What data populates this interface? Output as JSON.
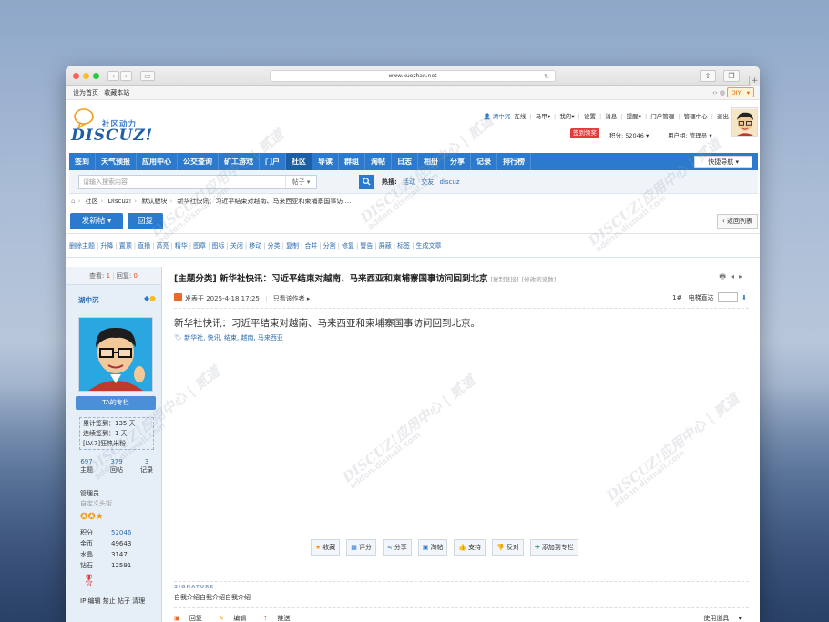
{
  "browser": {
    "url": "www.kuozhan.net",
    "traffic_colors": [
      "#fe5f57",
      "#febc2e",
      "#28c840"
    ]
  },
  "topbar": {
    "set_home": "设为首页",
    "bookmark": "收藏本站",
    "diy": "DIY"
  },
  "logo": {
    "subtitle": "社区动力",
    "brand": "DISCUZ!"
  },
  "user_menu": {
    "username": "湖中沉",
    "status": "在线",
    "horse": "马甲",
    "mine": "我的",
    "settings": "设置",
    "messages": "消息",
    "reminders": "提醒",
    "portal_admin": "门户管理",
    "admin_center": "管理中心",
    "logout": "退出",
    "sign_in_label": "签到领奖",
    "credits_label": "积分: 52046",
    "user_group_label": "用户组: 管理员"
  },
  "nav": {
    "items": [
      "签到",
      "天气预报",
      "应用中心",
      "公交查询",
      "矿工游戏",
      "门户",
      "社区",
      "导读",
      "群组",
      "淘帖",
      "日志",
      "相册",
      "分享",
      "记录",
      "排行榜"
    ],
    "active_index": 6,
    "quick_nav": "快捷导航"
  },
  "search": {
    "placeholder": "请输入搜索内容",
    "type": "帖子",
    "hot_label": "热搜:",
    "hot_items": [
      "活动",
      "交友",
      "discuz"
    ]
  },
  "breadcrumb": [
    "社区",
    "Discuz!",
    "默认版块",
    "新华社快讯：习近平结束对越南、马来西亚和柬埔寨国事访 ..."
  ],
  "actions": {
    "new_post": "发新帖",
    "reply": "回复",
    "back_list": "返回列表"
  },
  "moderation": [
    "删除主题",
    "升降",
    "置顶",
    "直播",
    "高亮",
    "精华",
    "图章",
    "图标",
    "关闭",
    "移动",
    "分类",
    "复制",
    "合并",
    "分割",
    "修复",
    "警告",
    "屏蔽",
    "标签",
    "生成文章"
  ],
  "thread": {
    "views_label": "查看:",
    "views": "1",
    "replies_label": "回复:",
    "replies": "0",
    "title": "[主题分类] 新华社快讯：习近平结束对越南、马来西亚和柬埔寨国事访问回到北京",
    "copy_link": "[复制链接]",
    "edit_views": "[修改浏览数]"
  },
  "author": {
    "name": "湖中沉",
    "column_button": "TA的专栏",
    "sign_total": "累计签到：135 天",
    "sign_streak": "连续签到：1 天",
    "sign_level": "[LV.7]狂热米粉",
    "stats": [
      {
        "value": "697",
        "label": "主题"
      },
      {
        "value": "379",
        "label": "回帖"
      },
      {
        "value": "3",
        "label": "记录"
      }
    ],
    "group": "管理员",
    "custom_title": "自定义头衔",
    "credits": [
      {
        "key": "积分",
        "value": "52046"
      },
      {
        "key": "金币",
        "value": "49643"
      },
      {
        "key": "水晶",
        "value": "3147"
      },
      {
        "key": "钻石",
        "value": "12591"
      }
    ],
    "ops": "IP 编辑 禁止 帖子 清理"
  },
  "post": {
    "posted_at": "发表于 2025-4-18 17:25",
    "only_author": "只看该作者",
    "floor": "1#",
    "goto_label": "电梯直达",
    "content": "新华社快讯：习近平结束对越南、马来西亚和柬埔寨国事访问回到北京。",
    "tags": "新华社, 快讯, 结束, 越南, 马来西亚",
    "buttons": [
      "收藏",
      "评分",
      "分享",
      "淘帖",
      "支持",
      "反对",
      "添加到专栏"
    ],
    "signature_label": "SIGNATURE",
    "signature": "自我介绍自我介绍自我介绍",
    "bottom_actions": [
      "回复",
      "编辑",
      "推送"
    ],
    "manage": "使用道具"
  },
  "watermark": {
    "line1": "DISCUZ!应用中心 | 贰道",
    "line2": "addon.dismall.com"
  }
}
